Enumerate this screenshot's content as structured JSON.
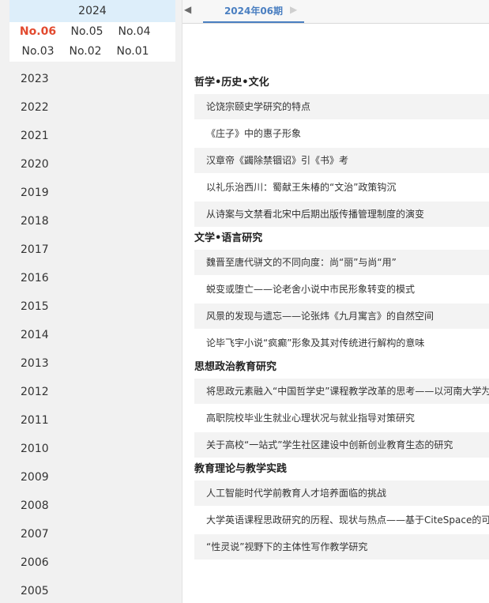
{
  "sidebar": {
    "active_year": "2024",
    "issues": [
      "No.06",
      "No.05",
      "No.04",
      "No.03",
      "No.02",
      "No.01"
    ],
    "selected_issue": "No.06",
    "years": [
      "2023",
      "2022",
      "2021",
      "2020",
      "2019",
      "2018",
      "2017",
      "2016",
      "2015",
      "2014",
      "2013",
      "2012",
      "2011",
      "2010",
      "2009",
      "2008",
      "2007",
      "2006",
      "2005"
    ]
  },
  "topbar": {
    "prev_arrow": "◀",
    "next_arrow": "▶",
    "current_issue": "2024年06期"
  },
  "sections": [
    {
      "title": "哲学•历史•文化",
      "articles": [
        "论饶宗颐史学研究的特点",
        "《庄子》中的惠子形象",
        "汉章帝《蠲除禁锢诏》引《书》考",
        "以礼乐治西川：蜀献王朱椿的“文治”政策钩沉",
        "从诗案与文禁看北宋中后期出版传播管理制度的演变"
      ]
    },
    {
      "title": "文学•语言研究",
      "articles": [
        "魏晋至唐代骈文的不同向度：尚“丽”与尚“用”",
        "蜕变或堕亡——论老舍小说中市民形象转变的模式",
        "风景的发现与遗忘——论张炜《九月寓言》的自然空间",
        "论毕飞宇小说“疯癫”形象及其对传统进行解构的意味"
      ]
    },
    {
      "title": "思想政治教育研究",
      "articles": [
        "将思政元素融入“中国哲学史”课程教学改革的思考——以河南大学为",
        "高职院校毕业生就业心理状况与就业指导对策研究",
        "关于高校“一站式”学生社区建设中创新创业教育生态的研究"
      ]
    },
    {
      "title": "教育理论与教学实践",
      "articles": [
        "人工智能时代学前教育人才培养面临的挑战",
        "大学英语课程思政研究的历程、现状与热点——基于CiteSpace的可",
        "“性灵说”视野下的主体性写作教学研究"
      ]
    }
  ]
}
